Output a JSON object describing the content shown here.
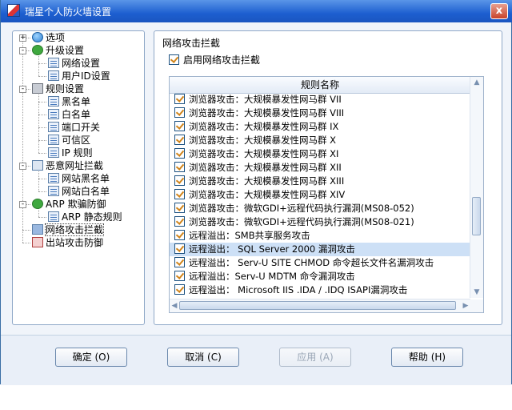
{
  "window": {
    "title": "瑞星个人防火墙设置",
    "close_label": "x"
  },
  "tree": {
    "items": [
      {
        "label": "选项",
        "icon": "globe-icon"
      },
      {
        "label": "升级设置",
        "icon": "check-icon"
      },
      {
        "label": "网络设置",
        "icon": "document-icon"
      },
      {
        "label": "用户ID设置",
        "icon": "document-icon"
      },
      {
        "label": "规则设置",
        "icon": "gear-icon"
      },
      {
        "label": "黑名单",
        "icon": "document-icon"
      },
      {
        "label": "白名单",
        "icon": "document-icon"
      },
      {
        "label": "端口开关",
        "icon": "document-icon"
      },
      {
        "label": "可信区",
        "icon": "document-icon"
      },
      {
        "label": "IP 规则",
        "icon": "document-icon"
      },
      {
        "label": "恶意网址拦截",
        "icon": "monitor-icon"
      },
      {
        "label": "网站黑名单",
        "icon": "document-icon"
      },
      {
        "label": "网站白名单",
        "icon": "document-icon"
      },
      {
        "label": "ARP 欺骗防御",
        "icon": "arp-icon"
      },
      {
        "label": "ARP 静态规则",
        "icon": "document-icon"
      },
      {
        "label": "网络攻击拦截",
        "icon": "monitor-icon"
      },
      {
        "label": "出站攻击防御",
        "icon": "monitor-red-icon"
      }
    ]
  },
  "main": {
    "section_title": "网络攻击拦截",
    "enable_label": "启用网络攻击拦截",
    "enable_checked": true,
    "list": {
      "header": "规则名称",
      "rows": [
        {
          "name": "浏览器攻击：大规模暴发性网马群 VII",
          "checked": true
        },
        {
          "name": "浏览器攻击：大规模暴发性网马群 VIII",
          "checked": true
        },
        {
          "name": "浏览器攻击：大规模暴发性网马群 IX",
          "checked": true
        },
        {
          "name": "浏览器攻击：大规模暴发性网马群 X",
          "checked": true
        },
        {
          "name": "浏览器攻击：大规模暴发性网马群 XI",
          "checked": true
        },
        {
          "name": "浏览器攻击：大规模暴发性网马群 XII",
          "checked": true
        },
        {
          "name": "浏览器攻击：大规模暴发性网马群 XIII",
          "checked": true
        },
        {
          "name": "浏览器攻击：大规模暴发性网马群 XIV",
          "checked": true
        },
        {
          "name": "浏览器攻击：微软GDI+远程代码执行漏洞(MS08-052)",
          "checked": true
        },
        {
          "name": "浏览器攻击：微软GDI+远程代码执行漏洞(MS08-021)",
          "checked": true
        },
        {
          "name": "远程溢出：SMB共享服务攻击",
          "checked": true
        },
        {
          "name": "远程溢出： SQL Server 2000 漏洞攻击",
          "checked": true
        },
        {
          "name": "远程溢出： Serv-U SITE CHMOD 命令超长文件名漏洞攻击",
          "checked": true
        },
        {
          "name": "远程溢出：Serv-U MDTM 命令漏洞攻击",
          "checked": true
        },
        {
          "name": "远程溢出： Microsoft IIS .IDA / .IDQ ISAPI漏洞攻击",
          "checked": true
        }
      ],
      "selected_index": 11
    }
  },
  "buttons": {
    "ok": "确定 (O)",
    "cancel": "取消 (C)",
    "apply": "应用 (A)",
    "help": "帮助 (H)"
  },
  "colors": {
    "titlebar": "#1d5fd0",
    "selection": "#cde0f6",
    "check": "#d0841a"
  }
}
